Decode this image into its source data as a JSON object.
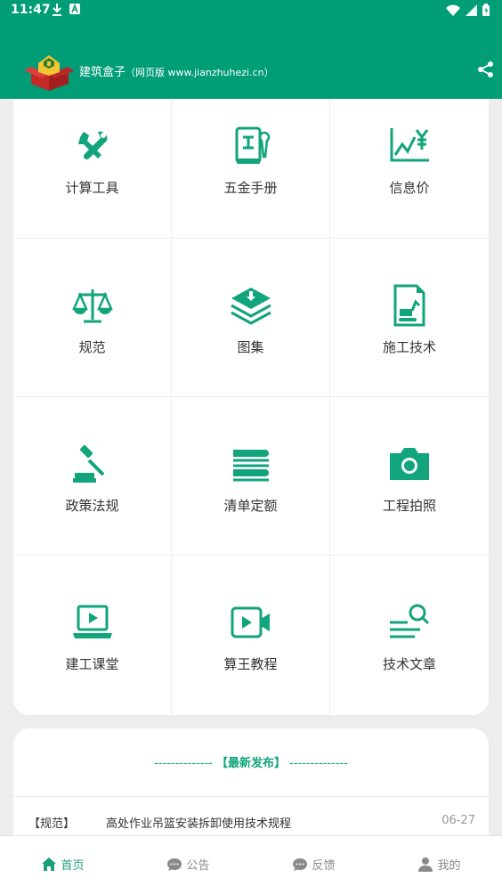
{
  "status_bar": {
    "time": "11:47"
  },
  "app_bar": {
    "title": "建筑盒子",
    "subtitle": "（网页版 www.jianzhuhezi.cn）"
  },
  "grid": {
    "items": [
      {
        "label": "计算工具",
        "icon": "tools-icon"
      },
      {
        "label": "五金手册",
        "icon": "manual-icon"
      },
      {
        "label": "信息价",
        "icon": "price-chart-icon"
      },
      {
        "label": "规范",
        "icon": "scale-icon"
      },
      {
        "label": "图集",
        "icon": "layers-icon"
      },
      {
        "label": "施工技术",
        "icon": "excavator-doc-icon"
      },
      {
        "label": "政策法规",
        "icon": "gavel-icon"
      },
      {
        "label": "清单定额",
        "icon": "books-icon"
      },
      {
        "label": "工程拍照",
        "icon": "camera-icon"
      },
      {
        "label": "建工课堂",
        "icon": "laptop-play-icon"
      },
      {
        "label": "算王教程",
        "icon": "video-camera-icon"
      },
      {
        "label": "技术文章",
        "icon": "search-list-icon"
      }
    ]
  },
  "news": {
    "header_left_dashes": "--------------",
    "header_title": "【最新发布】",
    "header_right_dashes": "--------------",
    "items": [
      {
        "tag": "【规范】",
        "title": "高处作业吊篮安装拆卸使用技术规程",
        "date": "06-27"
      }
    ]
  },
  "tabbar": {
    "tabs": [
      {
        "label": "首页",
        "icon": "home-icon",
        "active": true
      },
      {
        "label": "公告",
        "icon": "chat-icon",
        "active": false
      },
      {
        "label": "反馈",
        "icon": "feedback-icon",
        "active": false
      },
      {
        "label": "我的",
        "icon": "user-icon",
        "active": false
      }
    ]
  },
  "colors": {
    "primary": "#009d76",
    "icon": "#11a47d",
    "background": "#ededed"
  }
}
